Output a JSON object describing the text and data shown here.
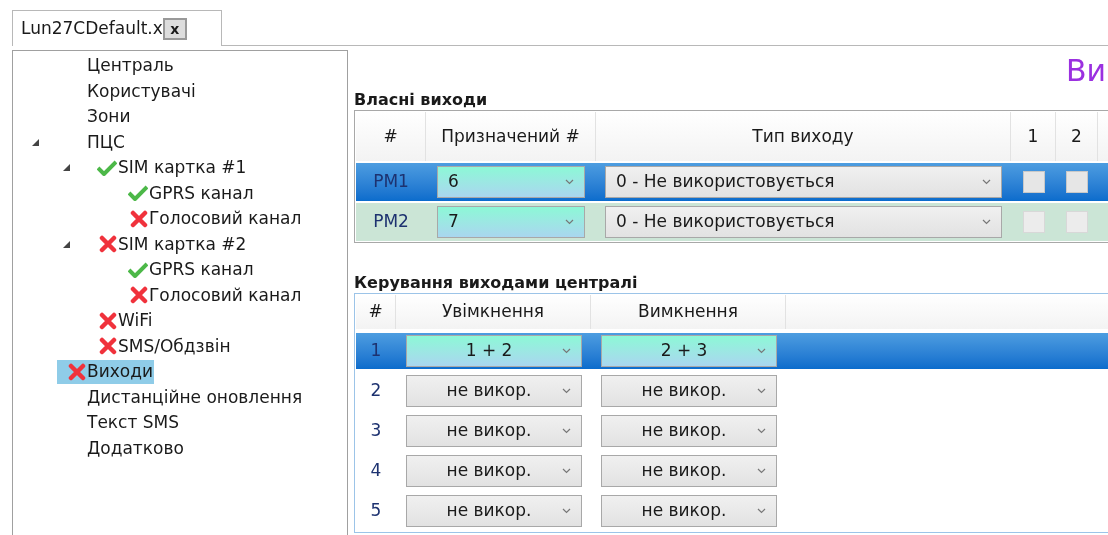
{
  "tab": {
    "title": "Lun27CDefault.x",
    "close": "x"
  },
  "tree": [
    {
      "label": "Централь",
      "selected": false
    },
    {
      "label": "Користувачі",
      "selected": false
    },
    {
      "label": "Зони",
      "selected": false
    },
    {
      "label": "ПЦС",
      "selected": false,
      "expanded": true,
      "children": [
        {
          "label": "SIM картка #1",
          "valid": true,
          "selected": false,
          "expanded": true,
          "children": [
            {
              "label": "GPRS канал",
              "valid": true,
              "selected": false
            },
            {
              "label": "Голосовий канал",
              "valid": false,
              "selected": false
            }
          ]
        },
        {
          "label": "SIM картка #2",
          "valid": false,
          "selected": false,
          "expanded": true,
          "children": [
            {
              "label": "GPRS канал",
              "valid": true,
              "selected": false
            },
            {
              "label": "Голосовий канал",
              "valid": false,
              "selected": false
            }
          ]
        },
        {
          "label": "WiFi",
          "valid": false,
          "selected": false
        },
        {
          "label": "SMS/Обдзвін",
          "valid": false,
          "selected": false
        }
      ]
    },
    {
      "label": "Виходи",
      "valid": false,
      "selected": true
    },
    {
      "label": "Дистанційне оновлення",
      "selected": false
    },
    {
      "label": "Текст SMS",
      "selected": false
    },
    {
      "label": "Додатково",
      "selected": false
    }
  ],
  "page_title": "Ви",
  "own_outputs": {
    "title": "Власні виходи",
    "columns": [
      "#",
      "Призначений #",
      "Тип виходу",
      "1",
      "2"
    ],
    "rows": [
      {
        "id": "PM1",
        "assigned": "6",
        "type": "0 - Не використовується",
        "selected": true,
        "outputs": [
          {
            "checked": false
          },
          {
            "checked": false
          }
        ]
      },
      {
        "id": "PM2",
        "assigned": "7",
        "type": "0 - Не використовується",
        "selected": false,
        "outputs": [
          {
            "checked": false
          },
          {
            "checked": false
          }
        ]
      }
    ]
  },
  "control": {
    "title": "Керування виходами централі",
    "columns": [
      "#",
      "Увімкнення",
      "Вимкнення"
    ],
    "rows": [
      {
        "number": "1",
        "on": "1 + 2",
        "off": "2 + 3",
        "selected": true
      },
      {
        "number": "2",
        "on": "не викор.",
        "off": "не викор.",
        "selected": false
      },
      {
        "number": "3",
        "on": "не викор.",
        "off": "не викор.",
        "selected": false
      },
      {
        "number": "4",
        "on": "не викор.",
        "off": "не викор.",
        "selected": false
      },
      {
        "number": "5",
        "on": "не викор.",
        "off": "не викор.",
        "selected": false
      }
    ]
  }
}
